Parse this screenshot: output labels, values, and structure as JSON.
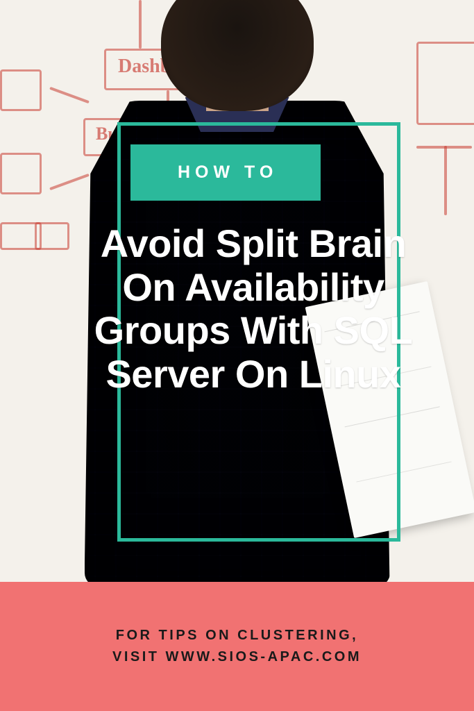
{
  "colors": {
    "teal": "#2bb99b",
    "coral": "#f17272",
    "white": "#ffffff",
    "dark": "#1a1a1a"
  },
  "whiteboard": {
    "labels": [
      "Dashboard",
      "Budget"
    ]
  },
  "badge": {
    "label": "HOW TO"
  },
  "title": {
    "text": "Avoid Split Brain On Availability Groups With SQL Server On Linux"
  },
  "footer": {
    "line1": "FOR TIPS ON CLUSTERING,",
    "line2": "VISIT WWW.SIOS-APAC.COM"
  }
}
